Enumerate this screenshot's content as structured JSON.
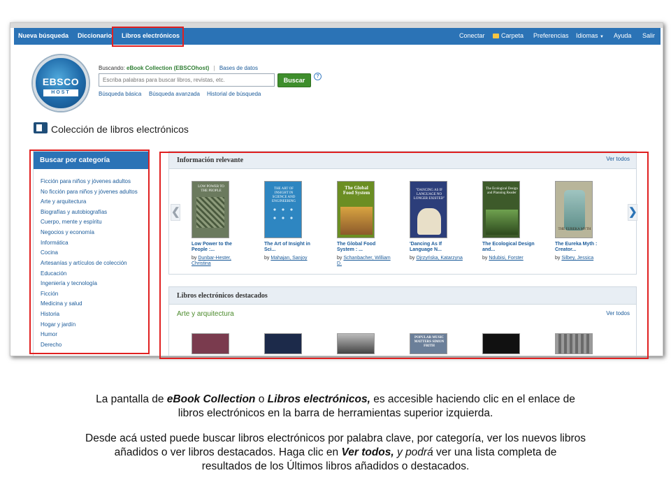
{
  "toolbar": {
    "left_items": [
      "Nueva búsqueda",
      "Diccionario",
      "Libros electrónicos"
    ],
    "right_items": [
      "Conectar",
      "Carpeta",
      "Preferencias",
      "Idiomas",
      "Ayuda",
      "Salir"
    ],
    "color": "#2b73b6"
  },
  "logo": {
    "top_text": "EBSCO",
    "bottom_text": "HOST"
  },
  "search": {
    "searching_label": "Buscando:",
    "database": "eBook Collection (EBSCOhost)",
    "separator": "|",
    "databases_link": "Bases de datos",
    "placeholder": "Escriba palabras para buscar libros, revistas, etc.",
    "button": "Buscar",
    "help": "?",
    "links": [
      "Búsqueda básica",
      "Búsqueda avanzada",
      "Historial de búsqueda"
    ]
  },
  "page_title": "Colección de libros electrónicos",
  "categories": {
    "header": "Buscar por categoría",
    "items": [
      "Ficción para niños y jóvenes adultos",
      "No ficción para niños y jóvenes adultos",
      "Arte y arquitectura",
      "Biografías y autobiografías",
      "Cuerpo, mente y espíritu",
      "Negocios y economía",
      "Informática",
      "Cocina",
      "Artesanías y artículos de colección",
      "Educación",
      "Ingeniería y tecnología",
      "Ficción",
      "Medicina y salud",
      "Historia",
      "Hogar y jardín",
      "Humor",
      "Derecho"
    ]
  },
  "relevant": {
    "title": "Información relevante",
    "see_all": "Ver todos",
    "arrow_left": "❮",
    "arrow_right": "❯",
    "books": [
      {
        "title1": "Low Power to the",
        "title2": "People :...",
        "by": "by",
        "author1": "Dunbar-Hester,",
        "author2": "Christina",
        "cover_text": "LOW POWER TO THE PEOPLE",
        "cover_color": "#6b7a5e"
      },
      {
        "title1": "The Art of Insight in",
        "title2": "Sci...",
        "by": "by",
        "author1": "Mahajan, Sanjoy",
        "author2": "",
        "cover_text": "THE ART OF INSIGHT IN SCIENCE AND ENGINEERING",
        "cover_color": "#2e86c1"
      },
      {
        "title1": "The Global Food",
        "title2": "System : ...",
        "by": "by",
        "author1": "Schanbacher, William",
        "author2": "D.",
        "cover_text": "The Global Food System",
        "cover_color": "#6b8e23"
      },
      {
        "title1": "'Dancing As If",
        "title2": "Language N...",
        "by": "by",
        "author1": "Ojrzyńska, Katarzyna",
        "author2": "",
        "cover_text": "\"DANCING AS IF LANGUAGE NO LONGER EXISTED\"",
        "cover_color": "#2c3e7a"
      },
      {
        "title1": "The Ecological Design",
        "title2": "and...",
        "by": "by",
        "author1": "Ndubisi, Forster",
        "author2": "",
        "cover_text": "The Ecological Design and Planning Reader",
        "cover_color": "#3d5a2a"
      },
      {
        "title1": "The Eureka Myth :",
        "title2": "Creator...",
        "by": "by",
        "author1": "Silbey, Jessica",
        "author2": "",
        "cover_text": "THE EUREKA MYTH",
        "cover_color": "#8a8f6a"
      }
    ]
  },
  "featured": {
    "title": "Libros electrónicos destacados",
    "subtitle": "Arte y arquitectura",
    "see_all": "Ver todos",
    "cover_colors": [
      "#7a3b4e",
      "#1c2a4a",
      "#555555",
      "#6b7f99",
      "#111111",
      "#777777"
    ],
    "cover_labels": [
      "",
      "",
      "",
      "POPULAR MUSIC MATTERS SIMON FRITH",
      "",
      ""
    ]
  },
  "caption": {
    "p1_a": "La pantalla de ",
    "p1_b": "eBook Collection",
    "p1_c": " o ",
    "p1_d": "Libros electrónicos,",
    "p1_e": " es accesible haciendo clic en el enlace de",
    "p1_line2": "libros electrónicos en la barra de herramientas superior izquierda.",
    "p2_line1": "Desde acá usted puede buscar libros electrónicos por palabra clave, por categoría, ver los nuevos libros",
    "p2_line2_a": "añadidos o ver libros destacados. Haga clic  en ",
    "p2_line2_b": "Ver todos,",
    "p2_line2_c": " y podrá",
    "p2_line2_d": " ver una lista completa de",
    "p2_line3": "resultados de los Últimos libros añadidos o destacados."
  },
  "highlight_color": "#e02020"
}
